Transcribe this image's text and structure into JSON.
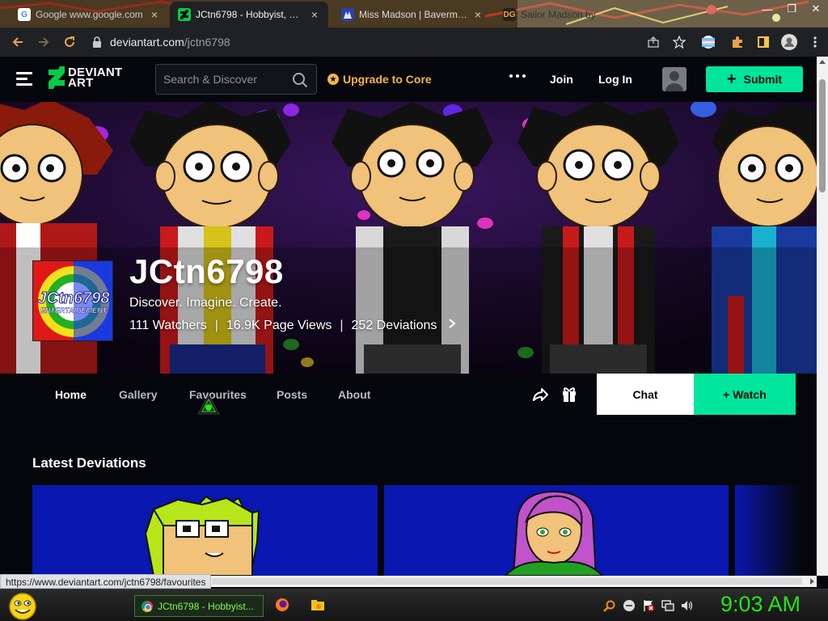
{
  "browser": {
    "tabs": [
      {
        "title": "Google www.google.com",
        "active": false,
        "favicon": "google-icon"
      },
      {
        "title": "JCtn6798 - Hobbyist, Pho",
        "active": true,
        "favicon": "deviantart-icon"
      },
      {
        "title": "Miss Madson | Baverman",
        "active": false,
        "favicon": "page-icon"
      },
      {
        "title": "Sailor Madson by",
        "active": false,
        "favicon": "dg-icon"
      }
    ],
    "tab_close_glyph": "×",
    "url_domain": "deviantart.com",
    "url_path": "/jctn6798"
  },
  "header": {
    "logo_line1": "DEVIANT",
    "logo_line2": "ART",
    "search_placeholder": "Search & Discover",
    "upgrade_label": "Upgrade to Core",
    "join_label": "Join",
    "login_label": "Log In",
    "submit_label": "Submit"
  },
  "profile": {
    "username": "JCtn6798",
    "tagline": "Discover. Imagine. Create.",
    "watchers": "111 Watchers",
    "pageviews": "16.9K Page Views",
    "deviations": "252 Deviations",
    "separator": "|",
    "avatar_text_main": "JCtn6798",
    "avatar_text_sub": "ENTERTAINEMENT"
  },
  "nav": {
    "items": [
      {
        "label": "Home",
        "active": true
      },
      {
        "label": "Gallery",
        "active": false
      },
      {
        "label": "Favourites",
        "active": false
      },
      {
        "label": "Posts",
        "active": false
      },
      {
        "label": "About",
        "active": false
      }
    ],
    "chat_label": "Chat",
    "watch_label": "+  Watch"
  },
  "section": {
    "latest_title": "Latest Deviations"
  },
  "status_bar": {
    "hover_url": "https://www.deviantart.com/jctn6798/favourites"
  },
  "taskbar": {
    "task_label": "JCtn6798 - Hobbyist...",
    "clock": "9:03 AM"
  },
  "colors": {
    "accent_green": "#00e59b",
    "upgrade_gold": "#f6b44a",
    "page_bg": "#06070d",
    "clock_green": "#22e61a"
  }
}
